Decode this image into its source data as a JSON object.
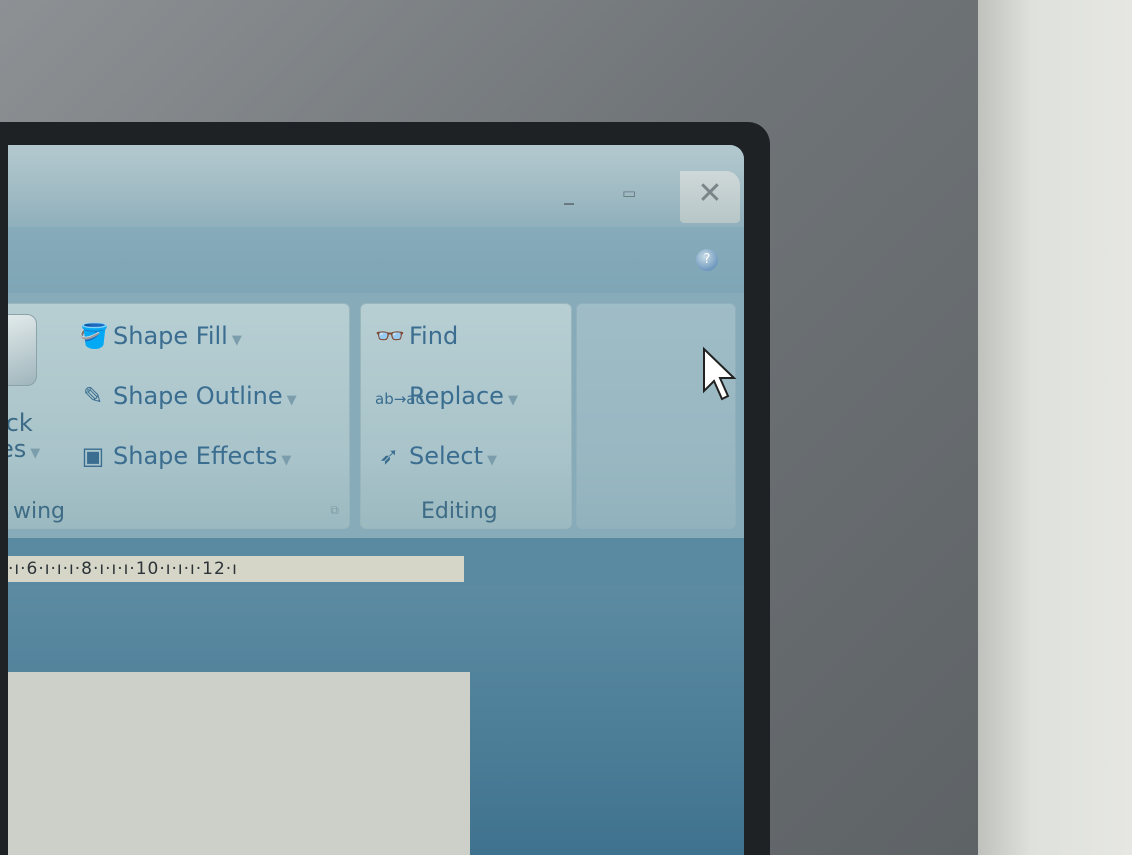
{
  "window": {
    "controls": {
      "minimize_icon": "minimize-icon",
      "maximize_icon": "maximize-icon",
      "close_icon": "close-icon"
    },
    "help_icon": "help-icon"
  },
  "ribbon": {
    "drawing_group": {
      "label": "wing",
      "quick_styles_label_line1": "ick",
      "quick_styles_label_line2": "es",
      "items": [
        {
          "label": "Shape Fill",
          "icon": "paint-bucket-icon"
        },
        {
          "label": "Shape Outline",
          "icon": "pencil-outline-icon"
        },
        {
          "label": "Shape Effects",
          "icon": "shape-effects-icon"
        }
      ]
    },
    "editing_group": {
      "label": "Editing",
      "items": [
        {
          "label": "Find",
          "icon": "binoculars-icon"
        },
        {
          "label": "Replace",
          "icon": "replace-icon"
        },
        {
          "label": "Select",
          "icon": "select-cursor-icon"
        }
      ]
    }
  },
  "ruler": {
    "text": "·ı·6·ı·ı·ı·8·ı·ı·ı·10·ı·ı·ı·12·ı"
  },
  "colors": {
    "accent_text": "#3a6d90",
    "screen_bg": "#4e7d96",
    "bezel": "#6f7477"
  }
}
